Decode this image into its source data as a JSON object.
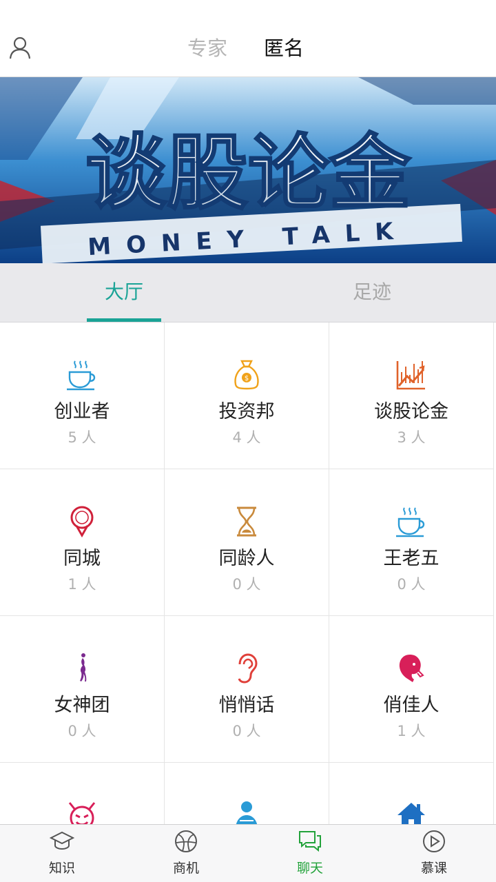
{
  "header": {
    "profile_icon": "user-icon",
    "segments": [
      {
        "label": "专家",
        "active": false
      },
      {
        "label": "匿名",
        "active": true
      }
    ]
  },
  "banner": {
    "title": "谈股论金",
    "subtitle": "MONEY TALK"
  },
  "tabs": [
    {
      "label": "大厅",
      "active": true
    },
    {
      "label": "足迹",
      "active": false
    }
  ],
  "colors": {
    "accent": "#1aa396",
    "active_bottom": "#22a23a",
    "muted": "#b0b0b0"
  },
  "rooms": [
    {
      "name": "创业者",
      "count": "5 人",
      "icon": "coffee-cup-icon"
    },
    {
      "name": "投资邦",
      "count": "4 人",
      "icon": "money-bag-icon"
    },
    {
      "name": "谈股论金",
      "count": "3 人",
      "icon": "stock-chart-icon"
    },
    {
      "name": "同城",
      "count": "1 人",
      "icon": "location-pin-icon"
    },
    {
      "name": "同龄人",
      "count": "0 人",
      "icon": "hourglass-icon"
    },
    {
      "name": "王老五",
      "count": "0 人",
      "icon": "coffee-cup-icon"
    },
    {
      "name": "女神团",
      "count": "0 人",
      "icon": "woman-silhouette-icon"
    },
    {
      "name": "悄悄话",
      "count": "0 人",
      "icon": "ear-icon"
    },
    {
      "name": "俏佳人",
      "count": "1 人",
      "icon": "lady-head-icon"
    },
    {
      "name": "",
      "count": "",
      "icon": "devil-face-icon"
    },
    {
      "name": "",
      "count": "",
      "icon": "person-icon"
    },
    {
      "name": "",
      "count": "",
      "icon": "house-icon"
    }
  ],
  "bottom_nav": [
    {
      "label": "知识",
      "icon": "graduation-cap-icon",
      "active": false
    },
    {
      "label": "商机",
      "icon": "ball-icon",
      "active": false
    },
    {
      "label": "聊天",
      "icon": "chat-bubbles-icon",
      "active": true
    },
    {
      "label": "慕课",
      "icon": "play-circle-icon",
      "active": false
    }
  ]
}
